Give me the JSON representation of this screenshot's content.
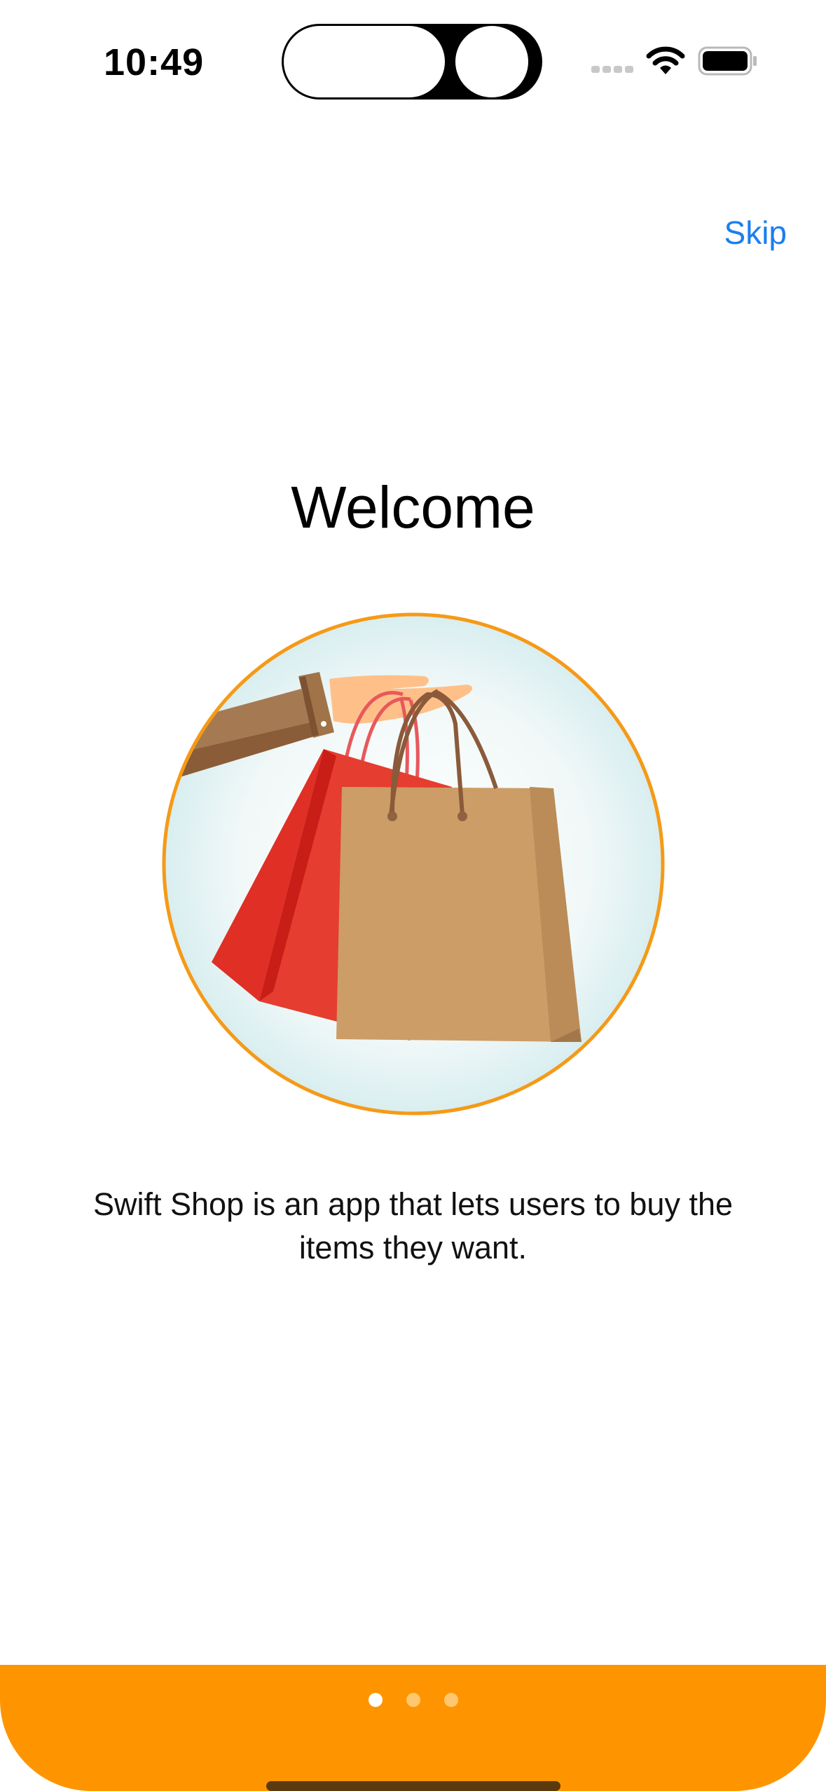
{
  "status_bar": {
    "time": "10:49"
  },
  "header": {
    "skip_label": "Skip"
  },
  "onboarding": {
    "title": "Welcome",
    "description": "Swift Shop is an app that lets users to buy the items they want.",
    "illustration": "hand-holding-shopping-bags",
    "page_count": 3,
    "current_page": 1
  },
  "colors": {
    "accent": "#FE9500",
    "link": "#1A7EF0",
    "dot_active": "#FFFFFF",
    "dot_inactive": "#FFC870"
  }
}
